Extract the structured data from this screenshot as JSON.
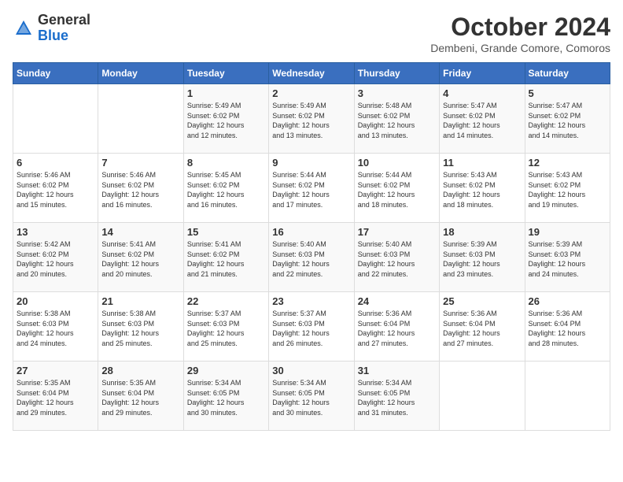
{
  "header": {
    "logo_general": "General",
    "logo_blue": "Blue",
    "month_title": "October 2024",
    "subtitle": "Dembeni, Grande Comore, Comoros"
  },
  "weekdays": [
    "Sunday",
    "Monday",
    "Tuesday",
    "Wednesday",
    "Thursday",
    "Friday",
    "Saturday"
  ],
  "weeks": [
    [
      {
        "day": "",
        "info": ""
      },
      {
        "day": "",
        "info": ""
      },
      {
        "day": "1",
        "info": "Sunrise: 5:49 AM\nSunset: 6:02 PM\nDaylight: 12 hours\nand 12 minutes."
      },
      {
        "day": "2",
        "info": "Sunrise: 5:49 AM\nSunset: 6:02 PM\nDaylight: 12 hours\nand 13 minutes."
      },
      {
        "day": "3",
        "info": "Sunrise: 5:48 AM\nSunset: 6:02 PM\nDaylight: 12 hours\nand 13 minutes."
      },
      {
        "day": "4",
        "info": "Sunrise: 5:47 AM\nSunset: 6:02 PM\nDaylight: 12 hours\nand 14 minutes."
      },
      {
        "day": "5",
        "info": "Sunrise: 5:47 AM\nSunset: 6:02 PM\nDaylight: 12 hours\nand 14 minutes."
      }
    ],
    [
      {
        "day": "6",
        "info": "Sunrise: 5:46 AM\nSunset: 6:02 PM\nDaylight: 12 hours\nand 15 minutes."
      },
      {
        "day": "7",
        "info": "Sunrise: 5:46 AM\nSunset: 6:02 PM\nDaylight: 12 hours\nand 16 minutes."
      },
      {
        "day": "8",
        "info": "Sunrise: 5:45 AM\nSunset: 6:02 PM\nDaylight: 12 hours\nand 16 minutes."
      },
      {
        "day": "9",
        "info": "Sunrise: 5:44 AM\nSunset: 6:02 PM\nDaylight: 12 hours\nand 17 minutes."
      },
      {
        "day": "10",
        "info": "Sunrise: 5:44 AM\nSunset: 6:02 PM\nDaylight: 12 hours\nand 18 minutes."
      },
      {
        "day": "11",
        "info": "Sunrise: 5:43 AM\nSunset: 6:02 PM\nDaylight: 12 hours\nand 18 minutes."
      },
      {
        "day": "12",
        "info": "Sunrise: 5:43 AM\nSunset: 6:02 PM\nDaylight: 12 hours\nand 19 minutes."
      }
    ],
    [
      {
        "day": "13",
        "info": "Sunrise: 5:42 AM\nSunset: 6:02 PM\nDaylight: 12 hours\nand 20 minutes."
      },
      {
        "day": "14",
        "info": "Sunrise: 5:41 AM\nSunset: 6:02 PM\nDaylight: 12 hours\nand 20 minutes."
      },
      {
        "day": "15",
        "info": "Sunrise: 5:41 AM\nSunset: 6:02 PM\nDaylight: 12 hours\nand 21 minutes."
      },
      {
        "day": "16",
        "info": "Sunrise: 5:40 AM\nSunset: 6:03 PM\nDaylight: 12 hours\nand 22 minutes."
      },
      {
        "day": "17",
        "info": "Sunrise: 5:40 AM\nSunset: 6:03 PM\nDaylight: 12 hours\nand 22 minutes."
      },
      {
        "day": "18",
        "info": "Sunrise: 5:39 AM\nSunset: 6:03 PM\nDaylight: 12 hours\nand 23 minutes."
      },
      {
        "day": "19",
        "info": "Sunrise: 5:39 AM\nSunset: 6:03 PM\nDaylight: 12 hours\nand 24 minutes."
      }
    ],
    [
      {
        "day": "20",
        "info": "Sunrise: 5:38 AM\nSunset: 6:03 PM\nDaylight: 12 hours\nand 24 minutes."
      },
      {
        "day": "21",
        "info": "Sunrise: 5:38 AM\nSunset: 6:03 PM\nDaylight: 12 hours\nand 25 minutes."
      },
      {
        "day": "22",
        "info": "Sunrise: 5:37 AM\nSunset: 6:03 PM\nDaylight: 12 hours\nand 25 minutes."
      },
      {
        "day": "23",
        "info": "Sunrise: 5:37 AM\nSunset: 6:03 PM\nDaylight: 12 hours\nand 26 minutes."
      },
      {
        "day": "24",
        "info": "Sunrise: 5:36 AM\nSunset: 6:04 PM\nDaylight: 12 hours\nand 27 minutes."
      },
      {
        "day": "25",
        "info": "Sunrise: 5:36 AM\nSunset: 6:04 PM\nDaylight: 12 hours\nand 27 minutes."
      },
      {
        "day": "26",
        "info": "Sunrise: 5:36 AM\nSunset: 6:04 PM\nDaylight: 12 hours\nand 28 minutes."
      }
    ],
    [
      {
        "day": "27",
        "info": "Sunrise: 5:35 AM\nSunset: 6:04 PM\nDaylight: 12 hours\nand 29 minutes."
      },
      {
        "day": "28",
        "info": "Sunrise: 5:35 AM\nSunset: 6:04 PM\nDaylight: 12 hours\nand 29 minutes."
      },
      {
        "day": "29",
        "info": "Sunrise: 5:34 AM\nSunset: 6:05 PM\nDaylight: 12 hours\nand 30 minutes."
      },
      {
        "day": "30",
        "info": "Sunrise: 5:34 AM\nSunset: 6:05 PM\nDaylight: 12 hours\nand 30 minutes."
      },
      {
        "day": "31",
        "info": "Sunrise: 5:34 AM\nSunset: 6:05 PM\nDaylight: 12 hours\nand 31 minutes."
      },
      {
        "day": "",
        "info": ""
      },
      {
        "day": "",
        "info": ""
      }
    ]
  ]
}
